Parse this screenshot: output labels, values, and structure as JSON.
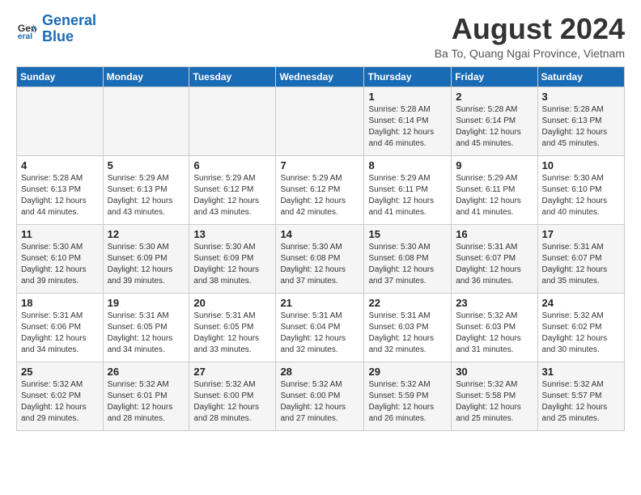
{
  "header": {
    "logo_line1": "General",
    "logo_line2": "Blue",
    "month_year": "August 2024",
    "location": "Ba To, Quang Ngai Province, Vietnam"
  },
  "weekdays": [
    "Sunday",
    "Monday",
    "Tuesday",
    "Wednesday",
    "Thursday",
    "Friday",
    "Saturday"
  ],
  "weeks": [
    [
      {
        "day": "",
        "info": ""
      },
      {
        "day": "",
        "info": ""
      },
      {
        "day": "",
        "info": ""
      },
      {
        "day": "",
        "info": ""
      },
      {
        "day": "1",
        "info": "Sunrise: 5:28 AM\nSunset: 6:14 PM\nDaylight: 12 hours\nand 46 minutes."
      },
      {
        "day": "2",
        "info": "Sunrise: 5:28 AM\nSunset: 6:14 PM\nDaylight: 12 hours\nand 45 minutes."
      },
      {
        "day": "3",
        "info": "Sunrise: 5:28 AM\nSunset: 6:13 PM\nDaylight: 12 hours\nand 45 minutes."
      }
    ],
    [
      {
        "day": "4",
        "info": "Sunrise: 5:28 AM\nSunset: 6:13 PM\nDaylight: 12 hours\nand 44 minutes."
      },
      {
        "day": "5",
        "info": "Sunrise: 5:29 AM\nSunset: 6:13 PM\nDaylight: 12 hours\nand 43 minutes."
      },
      {
        "day": "6",
        "info": "Sunrise: 5:29 AM\nSunset: 6:12 PM\nDaylight: 12 hours\nand 43 minutes."
      },
      {
        "day": "7",
        "info": "Sunrise: 5:29 AM\nSunset: 6:12 PM\nDaylight: 12 hours\nand 42 minutes."
      },
      {
        "day": "8",
        "info": "Sunrise: 5:29 AM\nSunset: 6:11 PM\nDaylight: 12 hours\nand 41 minutes."
      },
      {
        "day": "9",
        "info": "Sunrise: 5:29 AM\nSunset: 6:11 PM\nDaylight: 12 hours\nand 41 minutes."
      },
      {
        "day": "10",
        "info": "Sunrise: 5:30 AM\nSunset: 6:10 PM\nDaylight: 12 hours\nand 40 minutes."
      }
    ],
    [
      {
        "day": "11",
        "info": "Sunrise: 5:30 AM\nSunset: 6:10 PM\nDaylight: 12 hours\nand 39 minutes."
      },
      {
        "day": "12",
        "info": "Sunrise: 5:30 AM\nSunset: 6:09 PM\nDaylight: 12 hours\nand 39 minutes."
      },
      {
        "day": "13",
        "info": "Sunrise: 5:30 AM\nSunset: 6:09 PM\nDaylight: 12 hours\nand 38 minutes."
      },
      {
        "day": "14",
        "info": "Sunrise: 5:30 AM\nSunset: 6:08 PM\nDaylight: 12 hours\nand 37 minutes."
      },
      {
        "day": "15",
        "info": "Sunrise: 5:30 AM\nSunset: 6:08 PM\nDaylight: 12 hours\nand 37 minutes."
      },
      {
        "day": "16",
        "info": "Sunrise: 5:31 AM\nSunset: 6:07 PM\nDaylight: 12 hours\nand 36 minutes."
      },
      {
        "day": "17",
        "info": "Sunrise: 5:31 AM\nSunset: 6:07 PM\nDaylight: 12 hours\nand 35 minutes."
      }
    ],
    [
      {
        "day": "18",
        "info": "Sunrise: 5:31 AM\nSunset: 6:06 PM\nDaylight: 12 hours\nand 34 minutes."
      },
      {
        "day": "19",
        "info": "Sunrise: 5:31 AM\nSunset: 6:05 PM\nDaylight: 12 hours\nand 34 minutes."
      },
      {
        "day": "20",
        "info": "Sunrise: 5:31 AM\nSunset: 6:05 PM\nDaylight: 12 hours\nand 33 minutes."
      },
      {
        "day": "21",
        "info": "Sunrise: 5:31 AM\nSunset: 6:04 PM\nDaylight: 12 hours\nand 32 minutes."
      },
      {
        "day": "22",
        "info": "Sunrise: 5:31 AM\nSunset: 6:03 PM\nDaylight: 12 hours\nand 32 minutes."
      },
      {
        "day": "23",
        "info": "Sunrise: 5:32 AM\nSunset: 6:03 PM\nDaylight: 12 hours\nand 31 minutes."
      },
      {
        "day": "24",
        "info": "Sunrise: 5:32 AM\nSunset: 6:02 PM\nDaylight: 12 hours\nand 30 minutes."
      }
    ],
    [
      {
        "day": "25",
        "info": "Sunrise: 5:32 AM\nSunset: 6:02 PM\nDaylight: 12 hours\nand 29 minutes."
      },
      {
        "day": "26",
        "info": "Sunrise: 5:32 AM\nSunset: 6:01 PM\nDaylight: 12 hours\nand 28 minutes."
      },
      {
        "day": "27",
        "info": "Sunrise: 5:32 AM\nSunset: 6:00 PM\nDaylight: 12 hours\nand 28 minutes."
      },
      {
        "day": "28",
        "info": "Sunrise: 5:32 AM\nSunset: 6:00 PM\nDaylight: 12 hours\nand 27 minutes."
      },
      {
        "day": "29",
        "info": "Sunrise: 5:32 AM\nSunset: 5:59 PM\nDaylight: 12 hours\nand 26 minutes."
      },
      {
        "day": "30",
        "info": "Sunrise: 5:32 AM\nSunset: 5:58 PM\nDaylight: 12 hours\nand 25 minutes."
      },
      {
        "day": "31",
        "info": "Sunrise: 5:32 AM\nSunset: 5:57 PM\nDaylight: 12 hours\nand 25 minutes."
      }
    ]
  ]
}
